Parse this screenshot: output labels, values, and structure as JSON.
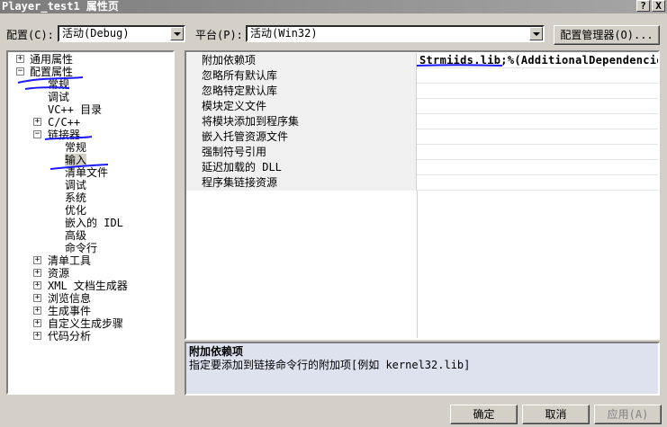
{
  "window": {
    "title": "Player_test1 属性页",
    "help_button": "?",
    "close_button": "X"
  },
  "config_bar": {
    "config_label": "配置(C):",
    "config_value": "活动(Debug)",
    "platform_label": "平台(P):",
    "platform_value": "活动(Win32)",
    "manager_button": "配置管理器(O)..."
  },
  "tree": {
    "general": "通用属性",
    "config_props": "配置属性",
    "general_sub": "常规",
    "debugging": "调试",
    "vcpp_dirs": "VC++ 目录",
    "cpp": "C/C++",
    "linker": "链接器",
    "linker_general": "常规",
    "linker_input": "输入",
    "linker_manifest": "清单文件",
    "linker_debugging": "调试",
    "linker_system": "系统",
    "linker_optimization": "优化",
    "linker_embedded_idl": "嵌入的 IDL",
    "linker_advanced": "高级",
    "linker_cmdline": "命令行",
    "manifest_tool": "清单工具",
    "resources": "资源",
    "xml_doc": "XML 文档生成器",
    "browse_info": "浏览信息",
    "build_events": "生成事件",
    "custom_build": "自定义生成步骤",
    "code_analysis": "代码分析"
  },
  "grid": {
    "rows": [
      {
        "name": "附加依赖项",
        "value": "Strmiids.lib;%(AdditionalDependencies)"
      },
      {
        "name": "忽略所有默认库",
        "value": ""
      },
      {
        "name": "忽略特定默认库",
        "value": ""
      },
      {
        "name": "模块定义文件",
        "value": ""
      },
      {
        "name": "将模块添加到程序集",
        "value": ""
      },
      {
        "name": "嵌入托管资源文件",
        "value": ""
      },
      {
        "name": "强制符号引用",
        "value": ""
      },
      {
        "name": "延迟加载的 DLL",
        "value": ""
      },
      {
        "name": "程序集链接资源",
        "value": ""
      }
    ]
  },
  "description": {
    "title": "附加依赖项",
    "text": "指定要添加到链接命令行的附加项[例如 kernel32.lib]"
  },
  "buttons": {
    "ok": "确定",
    "cancel": "取消",
    "apply": "应用(A)"
  },
  "colors": {
    "annotation_underline": "#1a1aff",
    "dialog_bg": "#d4d0c8",
    "description_bg": "#dde2ee"
  }
}
